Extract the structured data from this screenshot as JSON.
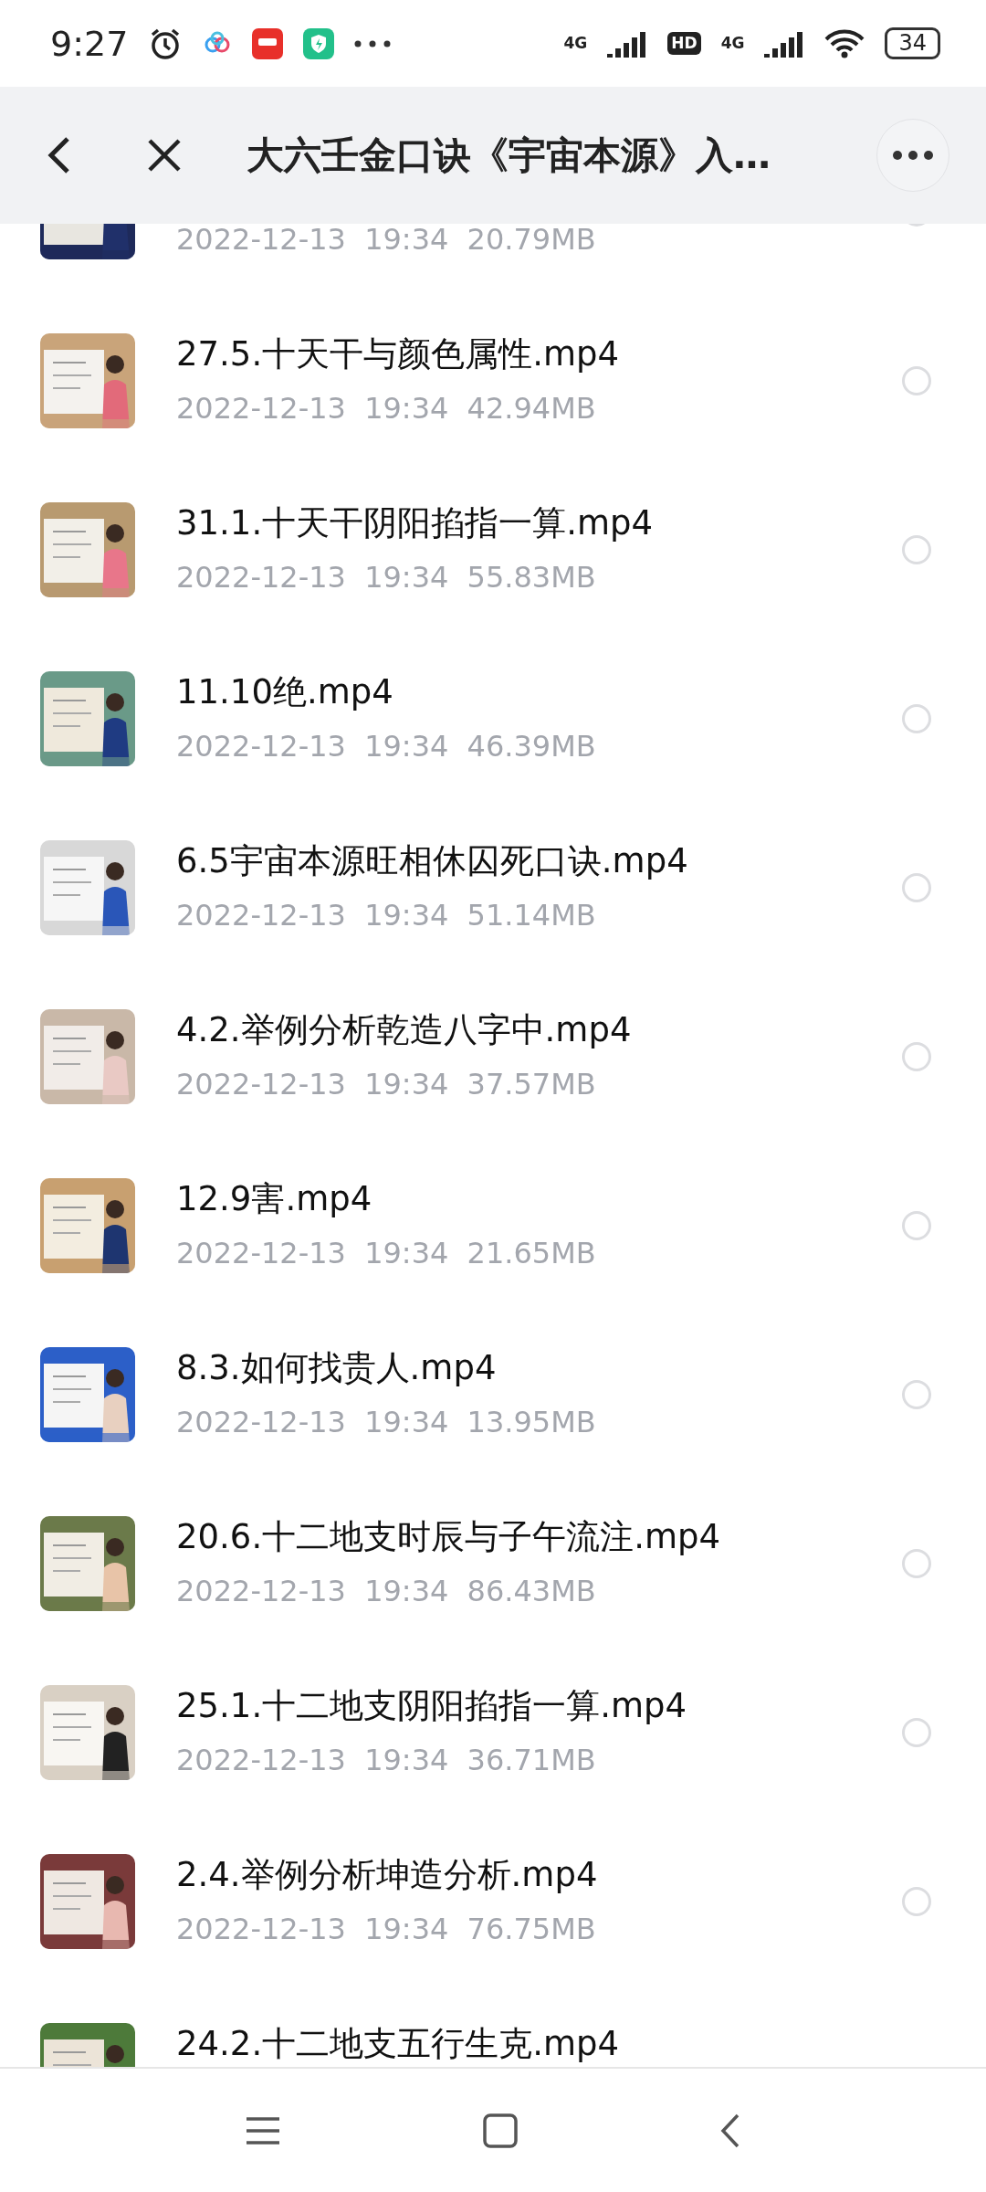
{
  "status_bar": {
    "time": "9:27",
    "network_1": "4G",
    "hd": "HD",
    "network_2": "4G",
    "battery": "34"
  },
  "header": {
    "title": "大六壬金口诀《宇宙本源》入…"
  },
  "files": [
    {
      "date": "2022-12-13",
      "time": "19:34",
      "size": "20.79MB",
      "selected": false
    },
    {
      "title": "27.5.十天干与颜色属性.mp4",
      "date": "2022-12-13",
      "time": "19:34",
      "size": "42.94MB",
      "selected": false
    },
    {
      "title": "31.1.十天干阴阳掐指一算.mp4",
      "date": "2022-12-13",
      "time": "19:34",
      "size": "55.83MB",
      "selected": false
    },
    {
      "title": "11.10绝.mp4",
      "date": "2022-12-13",
      "time": "19:34",
      "size": "46.39MB",
      "selected": false
    },
    {
      "title": "6.5宇宙本源旺相休囚死口诀.mp4",
      "date": "2022-12-13",
      "time": "19:34",
      "size": "51.14MB",
      "selected": false
    },
    {
      "title": "4.2.举例分析乾造八字中.mp4",
      "date": "2022-12-13",
      "time": "19:34",
      "size": "37.57MB",
      "selected": false
    },
    {
      "title": "12.9害.mp4",
      "date": "2022-12-13",
      "time": "19:34",
      "size": "21.65MB",
      "selected": false
    },
    {
      "title": "8.3.如何找贵人.mp4",
      "date": "2022-12-13",
      "time": "19:34",
      "size": "13.95MB",
      "selected": false
    },
    {
      "title": "20.6.十二地支时辰与子午流注.mp4",
      "date": "2022-12-13",
      "time": "19:34",
      "size": "86.43MB",
      "selected": false
    },
    {
      "title": "25.1.十二地支阴阳掐指一算.mp4",
      "date": "2022-12-13",
      "time": "19:34",
      "size": "36.71MB",
      "selected": false
    },
    {
      "title": "2.4.举例分析坤造分析.mp4",
      "date": "2022-12-13",
      "time": "19:34",
      "size": "76.75MB",
      "selected": false
    },
    {
      "title": "24.2.十二地支五行生克.mp4"
    }
  ]
}
